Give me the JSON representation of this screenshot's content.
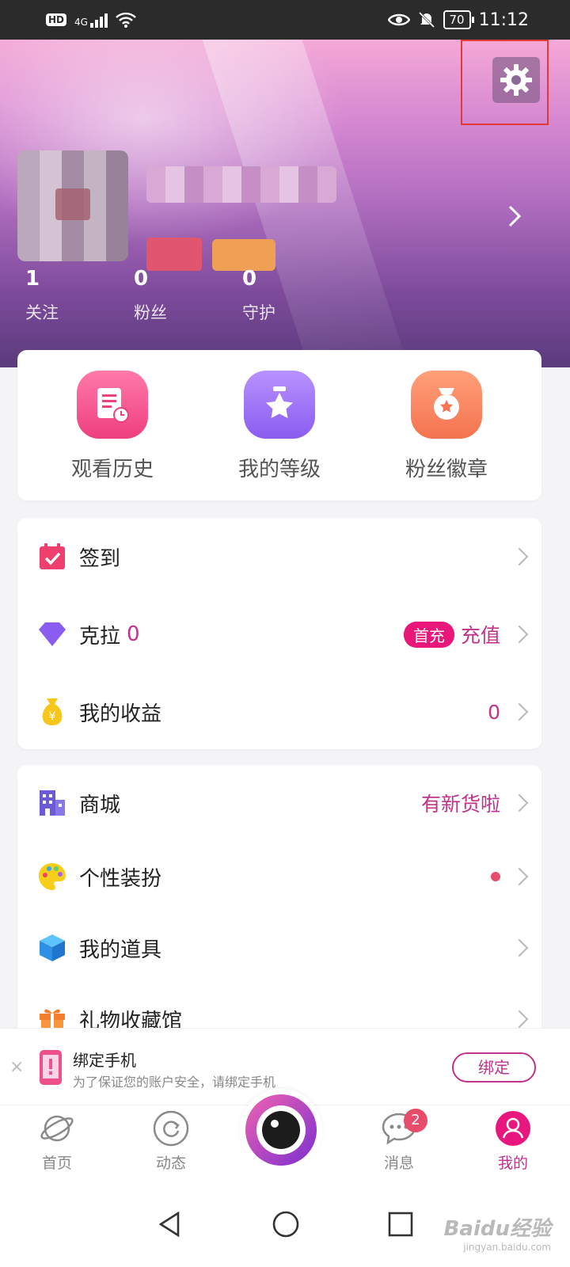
{
  "status_bar": {
    "hd": "HD",
    "network": "4G",
    "battery": "70",
    "time": "11:12"
  },
  "profile": {
    "stats": [
      {
        "value": "1",
        "label": "关注"
      },
      {
        "value": "0",
        "label": "粉丝"
      },
      {
        "value": "0",
        "label": "守护"
      }
    ]
  },
  "quick_actions": [
    {
      "label": "观看历史",
      "icon": "history-icon",
      "color": "#f2508a"
    },
    {
      "label": "我的等级",
      "icon": "star-level-icon",
      "color": "#9a6ef0"
    },
    {
      "label": "粉丝徽章",
      "icon": "fan-badge-icon",
      "color": "#f98062"
    }
  ],
  "wallet": {
    "checkin": "签到",
    "kela_label": "克拉",
    "kela_value": "0",
    "first_recharge": "首充",
    "recharge": "充值",
    "earnings_label": "我的收益",
    "earnings_value": "0"
  },
  "more": {
    "mall": "商城",
    "mall_note": "有新货啦",
    "dressup": "个性装扮",
    "props": "我的道具",
    "gifts": "礼物收藏馆"
  },
  "bind_phone": {
    "title": "绑定手机",
    "subtitle": "为了保证您的账户安全，请绑定手机",
    "button": "绑定",
    "close": "×"
  },
  "tabs": [
    {
      "label": "首页"
    },
    {
      "label": "动态"
    },
    {
      "label": "消息",
      "badge": "2"
    },
    {
      "label": "我的"
    }
  ],
  "colors": {
    "accent": "#c0338a",
    "highlight_box": "#e53935"
  },
  "watermark": {
    "main": "Baidu经验",
    "sub": "jingyan.baidu.com"
  }
}
